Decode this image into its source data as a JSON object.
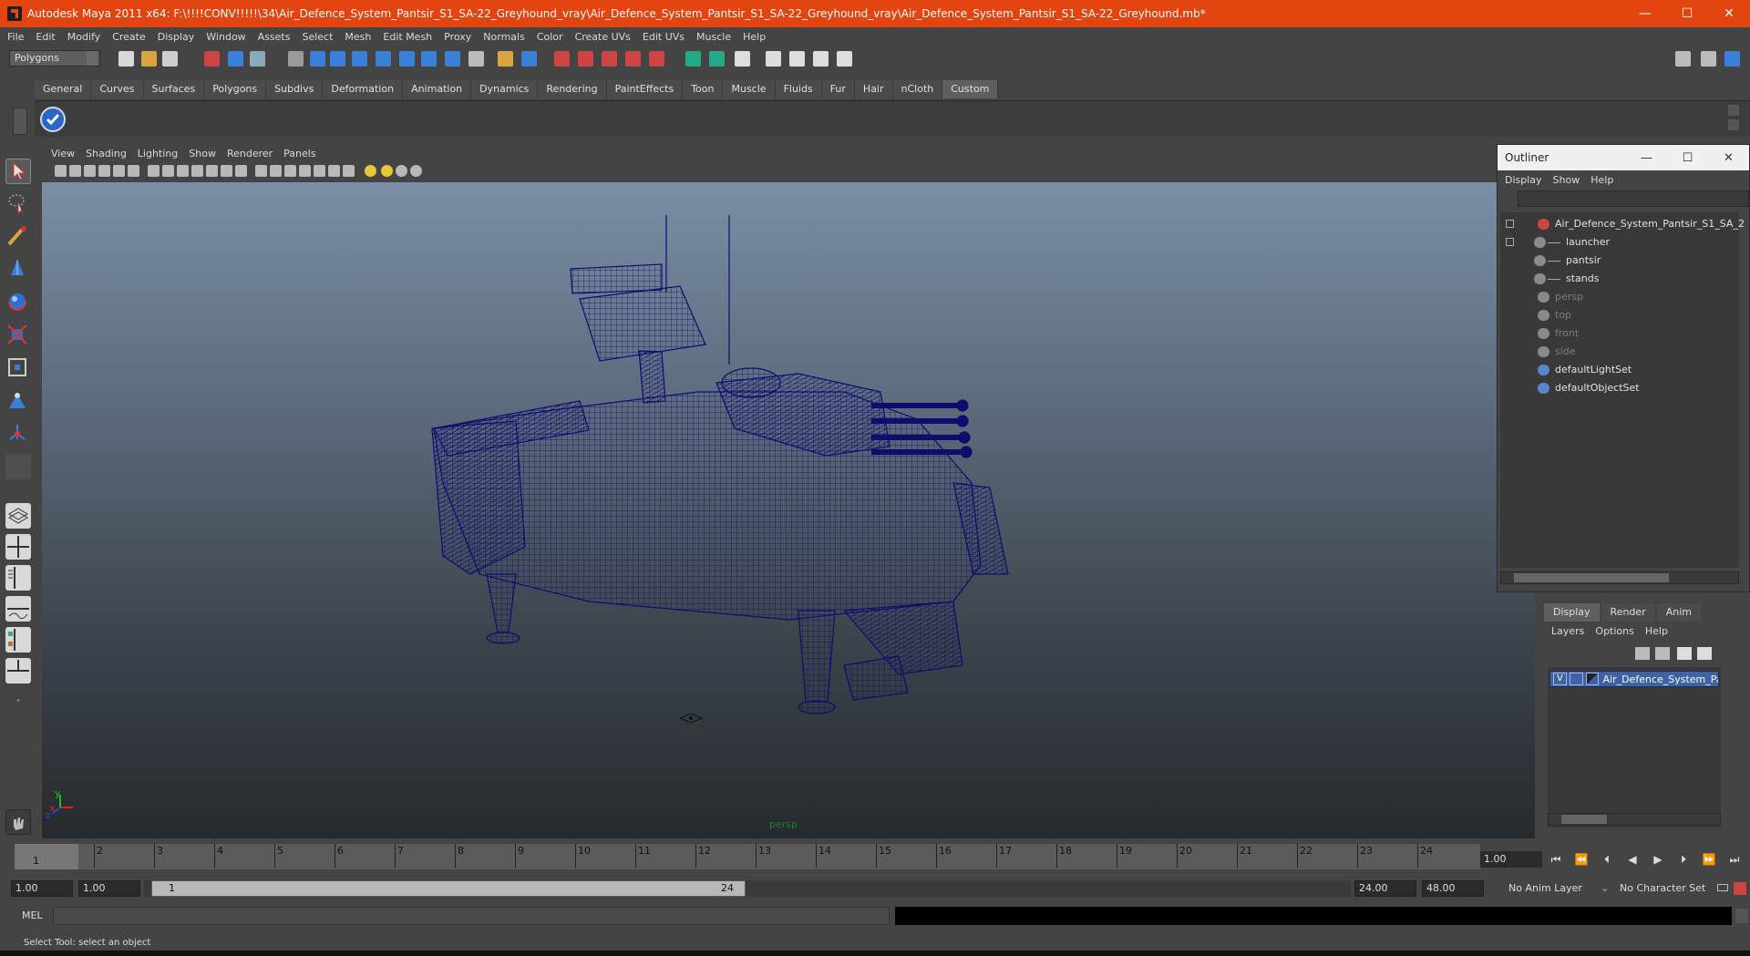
{
  "window": {
    "title": "Autodesk Maya 2011 x64: F:\\!!!!CONV!!!!!\\34\\Air_Defence_System_Pantsir_S1_SA-22_Greyhound_vray\\Air_Defence_System_Pantsir_S1_SA-22_Greyhound_vray\\Air_Defence_System_Pantsir_S1_SA-22_Greyhound.mb*",
    "minimize": "—",
    "maximize": "☐",
    "close": "✕"
  },
  "menubar": [
    "File",
    "Edit",
    "Modify",
    "Create",
    "Display",
    "Window",
    "Assets",
    "Select",
    "Mesh",
    "Edit Mesh",
    "Proxy",
    "Normals",
    "Color",
    "Create UVs",
    "Edit UVs",
    "Muscle",
    "Help"
  ],
  "statusline": {
    "menu_set": "Polygons"
  },
  "shelf": {
    "tabs": [
      "General",
      "Curves",
      "Surfaces",
      "Polygons",
      "Subdivs",
      "Deformation",
      "Animation",
      "Dynamics",
      "Rendering",
      "PaintEffects",
      "Toon",
      "Muscle",
      "Fluids",
      "Fur",
      "Hair",
      "nCloth",
      "Custom"
    ],
    "active_tab": "Custom"
  },
  "viewport": {
    "menu": [
      "View",
      "Shading",
      "Lighting",
      "Show",
      "Renderer",
      "Panels"
    ],
    "camera_label": "persp",
    "axis_x": "x",
    "axis_y": "y",
    "axis_z": "z"
  },
  "outliner": {
    "title": "Outliner",
    "menu": [
      "Display",
      "Show",
      "Help"
    ],
    "items": [
      {
        "label": "Air_Defence_System_Pantsir_S1_SA_2",
        "level": 0,
        "dim": false,
        "kind": "group"
      },
      {
        "label": "launcher",
        "level": 1,
        "dim": false,
        "kind": "mesh"
      },
      {
        "label": "pantsir",
        "level": 1,
        "dim": false,
        "kind": "mesh"
      },
      {
        "label": "stands",
        "level": 1,
        "dim": false,
        "kind": "mesh"
      },
      {
        "label": "persp",
        "level": 0,
        "dim": true,
        "kind": "camera"
      },
      {
        "label": "top",
        "level": 0,
        "dim": true,
        "kind": "camera"
      },
      {
        "label": "front",
        "level": 0,
        "dim": true,
        "kind": "camera"
      },
      {
        "label": "side",
        "level": 0,
        "dim": true,
        "kind": "camera"
      },
      {
        "label": "defaultLightSet",
        "level": 0,
        "dim": false,
        "kind": "set"
      },
      {
        "label": "defaultObjectSet",
        "level": 0,
        "dim": false,
        "kind": "set"
      }
    ]
  },
  "layers": {
    "tabs": [
      "Display",
      "Render",
      "Anim"
    ],
    "active_tab": "Display",
    "menu": [
      "Layers",
      "Options",
      "Help"
    ],
    "layer": {
      "visible": "V",
      "name": "Air_Defence_System_Pan"
    }
  },
  "timeline": {
    "ticks": [
      "1",
      "2",
      "3",
      "4",
      "5",
      "6",
      "7",
      "8",
      "9",
      "10",
      "11",
      "12",
      "13",
      "14",
      "15",
      "16",
      "17",
      "18",
      "19",
      "20",
      "21",
      "22",
      "23",
      "24"
    ],
    "current_frame_marker": "1",
    "current_frame": "1.00",
    "playback": [
      "⏮",
      "⏪",
      "⏴",
      "◀",
      "▶",
      "⏵",
      "⏩",
      "⏭"
    ]
  },
  "range": {
    "start_time": "1.00",
    "playback_start": "1.00",
    "range_min": "1",
    "range_max": "24",
    "playback_end": "24.00",
    "end_time": "48.00",
    "anim_layer": "No Anim Layer",
    "character_set": "No Character Set"
  },
  "command": {
    "label": "MEL"
  },
  "helpline": "Select Tool: select an object",
  "colors": {
    "title_bar": "#e2450f",
    "wire": "#0d0d6e",
    "layer_selected": "#3f61a6"
  }
}
